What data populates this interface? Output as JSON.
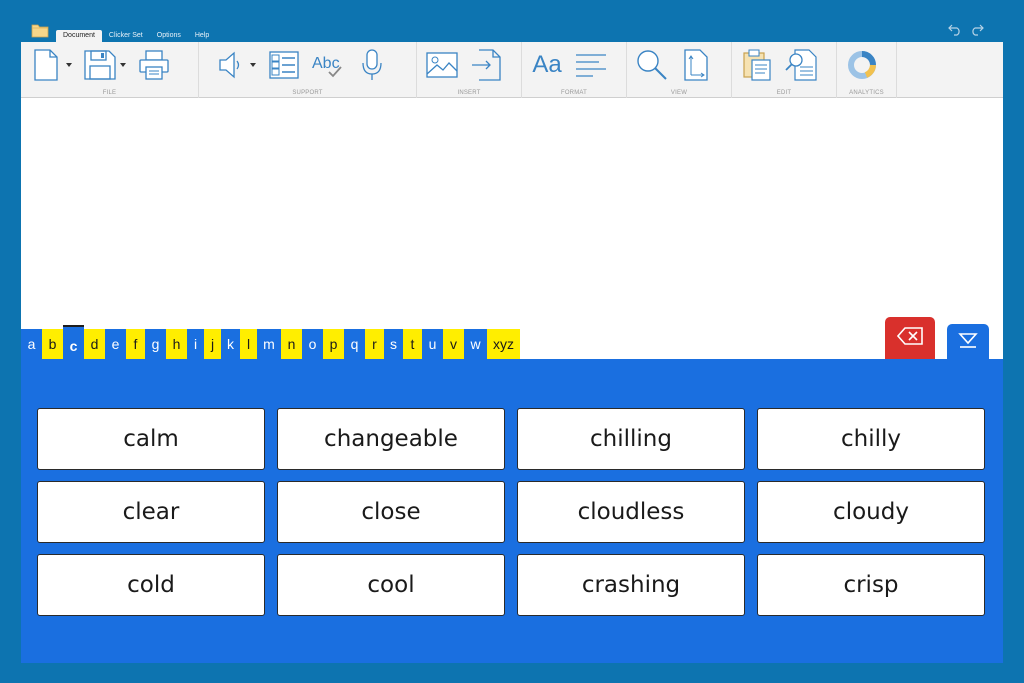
{
  "menu": {
    "tabs": [
      {
        "label": "Document"
      },
      {
        "label": "Clicker Set"
      },
      {
        "label": "Options"
      },
      {
        "label": "Help"
      }
    ]
  },
  "ribbon": {
    "groups": [
      {
        "label": "FILE"
      },
      {
        "label": "SUPPORT"
      },
      {
        "label": "INSERT"
      },
      {
        "label": "FORMAT"
      },
      {
        "label": "VIEW"
      },
      {
        "label": "EDIT"
      },
      {
        "label": "ANALYTICS"
      }
    ],
    "format_font_label": "Aa",
    "spell_label": "Abc"
  },
  "alphabet": {
    "letters": [
      {
        "label": "a",
        "color": "blue"
      },
      {
        "label": "b",
        "color": "yellow"
      },
      {
        "label": "c",
        "color": "blue",
        "active": true
      },
      {
        "label": "d",
        "color": "yellow"
      },
      {
        "label": "e",
        "color": "blue"
      },
      {
        "label": "f",
        "color": "yellow"
      },
      {
        "label": "g",
        "color": "blue"
      },
      {
        "label": "h",
        "color": "yellow"
      },
      {
        "label": "i",
        "color": "blue"
      },
      {
        "label": "j",
        "color": "yellow"
      },
      {
        "label": "k",
        "color": "blue"
      },
      {
        "label": "l",
        "color": "yellow"
      },
      {
        "label": "m",
        "color": "blue"
      },
      {
        "label": "n",
        "color": "yellow"
      },
      {
        "label": "o",
        "color": "blue"
      },
      {
        "label": "p",
        "color": "yellow"
      },
      {
        "label": "q",
        "color": "blue"
      },
      {
        "label": "r",
        "color": "yellow"
      },
      {
        "label": "s",
        "color": "blue"
      },
      {
        "label": "t",
        "color": "yellow"
      },
      {
        "label": "u",
        "color": "blue"
      },
      {
        "label": "v",
        "color": "yellow"
      },
      {
        "label": "w",
        "color": "blue"
      },
      {
        "label": "xyz",
        "color": "yellow"
      }
    ]
  },
  "words": [
    "calm",
    "changeable",
    "chilling",
    "chilly",
    "clear",
    "close",
    "cloudless",
    "cloudy",
    "cold",
    "cool",
    "crashing",
    "crisp"
  ],
  "colors": {
    "background": "#0d74b0",
    "panel_blue": "#1a6fe0",
    "letter_yellow": "#ffee00",
    "backspace_red": "#d9302c"
  }
}
